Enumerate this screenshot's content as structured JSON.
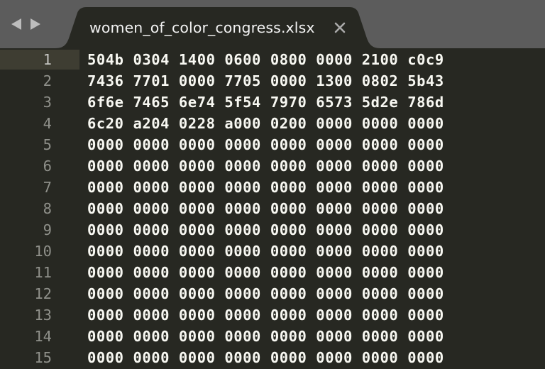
{
  "tab": {
    "title": "women_of_color_congress.xlsx",
    "close_icon": "close-icon"
  },
  "nav": {
    "back_icon": "back-arrow-icon",
    "forward_icon": "forward-arrow-icon"
  },
  "editor": {
    "lines": [
      {
        "number": "1",
        "text": "504b 0304 1400 0600 0800 0000 2100 c0c9"
      },
      {
        "number": "2",
        "text": "7436 7701 0000 7705 0000 1300 0802 5b43"
      },
      {
        "number": "3",
        "text": "6f6e 7465 6e74 5f54 7970 6573 5d2e 786d"
      },
      {
        "number": "4",
        "text": "6c20 a204 0228 a000 0200 0000 0000 0000"
      },
      {
        "number": "5",
        "text": "0000 0000 0000 0000 0000 0000 0000 0000"
      },
      {
        "number": "6",
        "text": "0000 0000 0000 0000 0000 0000 0000 0000"
      },
      {
        "number": "7",
        "text": "0000 0000 0000 0000 0000 0000 0000 0000"
      },
      {
        "number": "8",
        "text": "0000 0000 0000 0000 0000 0000 0000 0000"
      },
      {
        "number": "9",
        "text": "0000 0000 0000 0000 0000 0000 0000 0000"
      },
      {
        "number": "10",
        "text": "0000 0000 0000 0000 0000 0000 0000 0000"
      },
      {
        "number": "11",
        "text": "0000 0000 0000 0000 0000 0000 0000 0000"
      },
      {
        "number": "12",
        "text": "0000 0000 0000 0000 0000 0000 0000 0000"
      },
      {
        "number": "13",
        "text": "0000 0000 0000 0000 0000 0000 0000 0000"
      },
      {
        "number": "14",
        "text": "0000 0000 0000 0000 0000 0000 0000 0000"
      },
      {
        "number": "15",
        "text": "0000 0000 0000 0000 0000 0000 0000 0000"
      }
    ]
  },
  "colors": {
    "background": "#272822",
    "tab_bar": "#5c5c5c",
    "text": "#f8f8f2",
    "line_number": "#8f908a",
    "current_line_gutter": "#3e3d32"
  }
}
